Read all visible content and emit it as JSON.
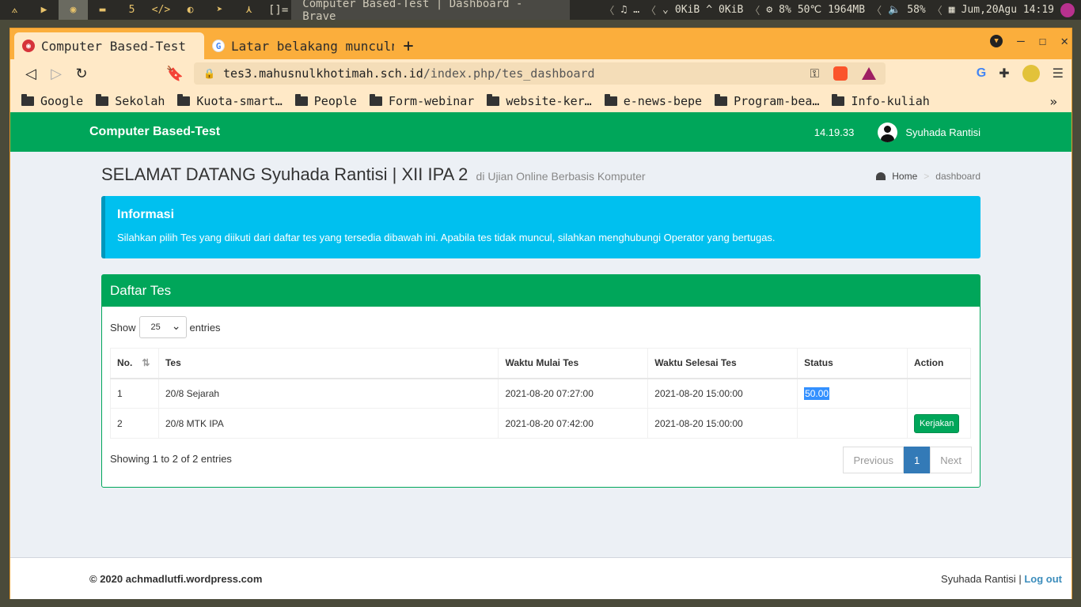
{
  "os": {
    "workspace_count": "5",
    "window_title": "Computer Based-Test | Dashboard - Brave",
    "layout_tag": "[]=",
    "music": "…",
    "net_down": "0KiB",
    "net_up": "0KiB",
    "cpu": "8%",
    "temp": "50℃",
    "mem": "1964MB",
    "volume": "58%",
    "datetime": "Jum,20Agu 14:19"
  },
  "browser": {
    "tabs": [
      {
        "title": "Computer Based-Test",
        "active": true
      },
      {
        "title": "Latar belakang munculnya",
        "active": false
      }
    ],
    "url_host": "tes3.mahusnulkhotimah.sch.id",
    "url_path": "/index.php/tes_dashboard",
    "bookmarks": [
      "Google",
      "Sekolah",
      "Kuota-smart…",
      "People",
      "Form-webinar",
      "website-ker…",
      "e-news-bepe",
      "Program-bea…",
      "Info-kuliah"
    ]
  },
  "page": {
    "brand": "Computer Based-Test",
    "clock": "14.19.33",
    "user_name": "Syuhada Rantisi",
    "heading": "SELAMAT DATANG Syuhada Rantisi | XII IPA 2",
    "subheading": "di Ujian Online Berbasis Komputer",
    "breadcrumb_home": "Home",
    "breadcrumb_current": "dashboard",
    "info_title": "Informasi",
    "info_text": "Silahkan pilih Tes yang diikuti dari daftar tes yang tersedia dibawah ini. Apabila tes tidak muncul, silahkan menghubungi Operator yang bertugas.",
    "box_title": "Daftar Tes",
    "show_label": "Show",
    "show_value": "25",
    "entries_label": "entries",
    "columns": [
      "No.",
      "Tes",
      "Waktu Mulai Tes",
      "Waktu Selesai Tes",
      "Status",
      "Action"
    ],
    "rows": [
      {
        "no": "1",
        "tes": "20/8 Sejarah",
        "mulai": "2021-08-20 07:27:00",
        "selesai": "2021-08-20 15:00:00",
        "status": "50.00",
        "action": ""
      },
      {
        "no": "2",
        "tes": "20/8 MTK IPA",
        "mulai": "2021-08-20 07:42:00",
        "selesai": "2021-08-20 15:00:00",
        "status": "",
        "action": "Kerjakan"
      }
    ],
    "showing_text": "Showing 1 to 2 of 2 entries",
    "pager_prev": "Previous",
    "pager_current": "1",
    "pager_next": "Next",
    "footer_copy": "© 2020 achmadlutfi.wordpress.com",
    "footer_user": "Syuhada Rantisi",
    "footer_sep": "|",
    "footer_logout": "Log out"
  },
  "colors": {
    "primary_green": "#00a65a",
    "info_blue": "#00c0ef",
    "link_blue": "#3c8dbc",
    "browser_orange": "#fbae3c"
  }
}
